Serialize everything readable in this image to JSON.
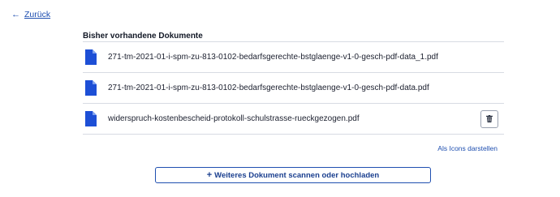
{
  "nav": {
    "back_arrow": "←",
    "back_label": "Zurück"
  },
  "section": {
    "title": "Bisher vorhandene Dokumente"
  },
  "documents": [
    {
      "name": "271-tm-2021-01-i-spm-zu-813-0102-bedarfsgerechte-bstglaenge-v1-0-gesch-pdf-data_1.pdf",
      "icon": "pdf-file-icon"
    },
    {
      "name": "271-tm-2021-01-i-spm-zu-813-0102-bedarfsgerechte-bstglaenge-v1-0-gesch-pdf-data.pdf",
      "icon": "pdf-file-icon"
    },
    {
      "name": "widerspruch-kostenbescheid-protokoll-schulstrasse-rueckgezogen.pdf",
      "icon": "pdf-file-icon"
    }
  ],
  "actions": {
    "delete_icon": "trash-icon",
    "view_toggle_label": "Als Icons darstellen",
    "upload_plus": "+",
    "upload_label": "Weiteres Dokument scannen oder hochladen"
  },
  "colors": {
    "accent": "#1f4fb0",
    "file_icon": "#1d4fd6",
    "divider": "#d7dbe3"
  }
}
